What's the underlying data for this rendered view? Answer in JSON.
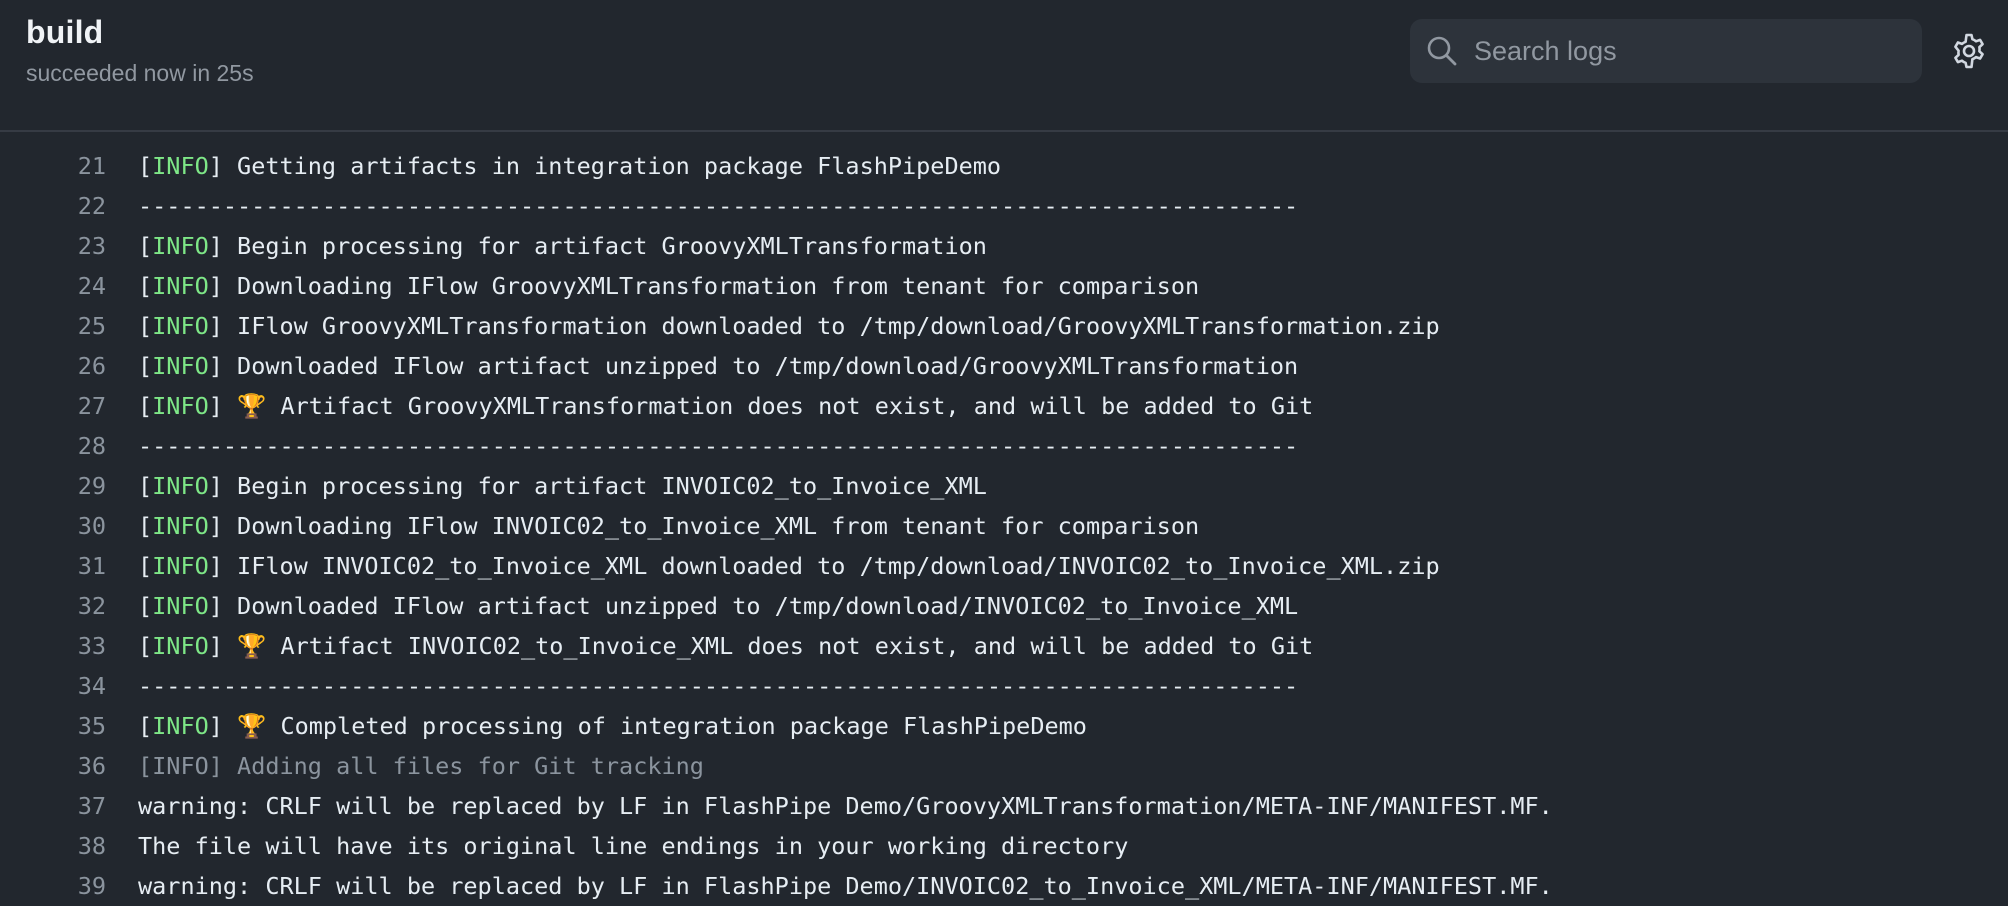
{
  "header": {
    "title": "build",
    "status": "succeeded now in 25s",
    "search_placeholder": "Search logs",
    "search_icon": "search-icon",
    "settings_icon": "gear-icon"
  },
  "colors": {
    "background": "#22272e",
    "info_tag": "#7ee787",
    "line_number": "#8b949e",
    "text": "#e6edf3"
  },
  "log_lines": [
    {
      "n": "21",
      "info": true,
      "text": "Getting artifacts in integration package FlashPipeDemo"
    },
    {
      "n": "22",
      "info": false,
      "text": "----------------------------------------------------------------------------------"
    },
    {
      "n": "23",
      "info": true,
      "text": "Begin processing for artifact GroovyXMLTransformation"
    },
    {
      "n": "24",
      "info": true,
      "text": "Downloading IFlow GroovyXMLTransformation from tenant for comparison"
    },
    {
      "n": "25",
      "info": true,
      "text": "IFlow GroovyXMLTransformation downloaded to /tmp/download/GroovyXMLTransformation.zip"
    },
    {
      "n": "26",
      "info": true,
      "text": "Downloaded IFlow artifact unzipped to /tmp/download/GroovyXMLTransformation"
    },
    {
      "n": "27",
      "info": true,
      "trophy": true,
      "text": "Artifact GroovyXMLTransformation does not exist, and will be added to Git"
    },
    {
      "n": "28",
      "info": false,
      "text": "----------------------------------------------------------------------------------"
    },
    {
      "n": "29",
      "info": true,
      "text": "Begin processing for artifact INVOIC02_to_Invoice_XML"
    },
    {
      "n": "30",
      "info": true,
      "text": "Downloading IFlow INVOIC02_to_Invoice_XML from tenant for comparison"
    },
    {
      "n": "31",
      "info": true,
      "text": "IFlow INVOIC02_to_Invoice_XML downloaded to /tmp/download/INVOIC02_to_Invoice_XML.zip"
    },
    {
      "n": "32",
      "info": true,
      "text": "Downloaded IFlow artifact unzipped to /tmp/download/INVOIC02_to_Invoice_XML"
    },
    {
      "n": "33",
      "info": true,
      "trophy": true,
      "text": "Artifact INVOIC02_to_Invoice_XML does not exist, and will be added to Git"
    },
    {
      "n": "34",
      "info": false,
      "text": "----------------------------------------------------------------------------------"
    },
    {
      "n": "35",
      "info": true,
      "trophy": true,
      "text": "Completed processing of integration package FlashPipeDemo"
    },
    {
      "n": "36",
      "info": true,
      "dim": true,
      "text": "Adding all files for Git tracking"
    },
    {
      "n": "37",
      "info": false,
      "text": "warning: CRLF will be replaced by LF in FlashPipe Demo/GroovyXMLTransformation/META-INF/MANIFEST.MF."
    },
    {
      "n": "38",
      "info": false,
      "text": "The file will have its original line endings in your working directory"
    },
    {
      "n": "39",
      "info": false,
      "text": "warning: CRLF will be replaced by LF in FlashPipe Demo/INVOIC02_to_Invoice_XML/META-INF/MANIFEST.MF."
    }
  ],
  "info_label": "INFO",
  "trophy_glyph": "🏆"
}
